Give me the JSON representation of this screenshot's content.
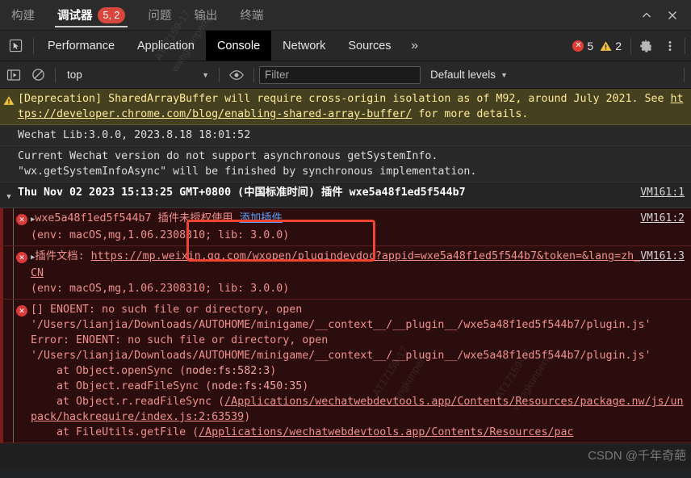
{
  "ide_bar": {
    "tabs": [
      {
        "label": "构建",
        "active": false
      },
      {
        "label": "调试器",
        "active": true,
        "badge": "5, 2"
      },
      {
        "label": "问题",
        "active": false
      },
      {
        "label": "输出",
        "active": false
      },
      {
        "label": "终端",
        "active": false
      }
    ],
    "collapse_icon": "chevron-up-icon",
    "close_icon": "close-icon"
  },
  "devtools_bar": {
    "inspect_icon": "inspect-element-icon",
    "tabs": [
      {
        "label": "Performance",
        "active": false
      },
      {
        "label": "Application",
        "active": false
      },
      {
        "label": "Console",
        "active": true
      },
      {
        "label": "Network",
        "active": false
      },
      {
        "label": "Sources",
        "active": false
      }
    ],
    "more_tabs_label": "»",
    "error_count": "5",
    "warning_count": "2",
    "settings_icon": "gear-icon",
    "kebab_icon": "more-vertical-icon"
  },
  "console_toolbar": {
    "sidebar_toggle_icon": "console-sidebar-icon",
    "clear_icon": "clear-console-icon",
    "context_value": "top",
    "context_caret": "▼",
    "live_expression_icon": "eye-icon",
    "filter_placeholder": "Filter",
    "filter_value": "",
    "levels_label": "Default levels",
    "levels_caret": "▼"
  },
  "messages": [
    {
      "id": "deprecation-warning",
      "kind": "warning",
      "icon": "warning-triangle-icon",
      "text_pre": "[Deprecation] SharedArrayBuffer will require cross-origin isolation as of M92, around July 2021. See ",
      "link": "https://developer.chrome.com/blog/enabling-shared-array-buffer/",
      "text_post": " for more details.",
      "vm": ""
    },
    {
      "id": "wechat-lib",
      "kind": "info",
      "icon": "",
      "text": "Wechat Lib:3.0.0, 2023.8.18 18:01:52",
      "vm": ""
    },
    {
      "id": "getsysteminfo-note",
      "kind": "plain",
      "icon": "",
      "text": "Current Wechat version do not support asynchronous getSystemInfo.\n\"wx.getSystemInfoAsync\" will be finished by synchronous implementation.",
      "vm": ""
    },
    {
      "id": "group-timestamp",
      "kind": "group",
      "icon": "disclosure-triangle-down-icon",
      "text": "Thu Nov 02 2023 15:13:25 GMT+0800 (中国标准时间) 插件 wxe5a48f1ed5f544b7",
      "vm": "VM161:1"
    },
    {
      "id": "plugin-unauthorized",
      "kind": "error",
      "icon": "error-circle-icon",
      "expand_icon": "disclosure-triangle-right-icon",
      "text_a": "wxe5a48f1ed5f544b7 插件未授权使用 ",
      "link_label": "添加插件",
      "text_b": "\n(env: macOS,mg,1.06.2308310; lib: 3.0.0)",
      "vm": "VM161:2"
    },
    {
      "id": "plugin-doc",
      "kind": "error",
      "icon": "error-circle-icon",
      "expand_icon": "disclosure-triangle-right-icon",
      "text_a": "插件文档: ",
      "link": "https://mp.weixin.qq.com/wxopen/plugindevdoc?appid=wxe5a48f1ed5f544b7&token=&lang=zh_CN",
      "text_b": "\n(env: macOS,mg,1.06.2308310; lib: 3.0.0)",
      "vm": "VM161:3"
    },
    {
      "id": "enoent-stack",
      "kind": "error",
      "icon": "error-circle-icon",
      "lines": [
        "[] ENOENT: no such file or directory, open",
        "'/Users/lianjia/Downloads/AUTOHOME/minigame/__context__/__plugin__/wxe5a48f1ed5f544b7/plugin.js'",
        "Error: ENOENT: no such file or directory, open",
        "'/Users/lianjia/Downloads/AUTOHOME/minigame/__context__/__plugin__/wxe5a48f1ed5f544b7/plugin.js'"
      ],
      "frames": [
        {
          "prefix": "    at Object.openSync (",
          "link": "node:fs:582:3",
          "suffix": ")",
          "linked": false
        },
        {
          "prefix": "    at Object.readFileSync (",
          "link": "node:fs:450:35",
          "suffix": ")",
          "linked": false
        },
        {
          "prefix": "    at Object.r.readFileSync (",
          "link": "/Applications/wechatwebdevtools.app/Contents/Resources/package.nw/js/unpack/hackrequire/index.js:2:63539",
          "suffix": ")",
          "linked": true
        },
        {
          "prefix": "    at FileUtils.getFile (",
          "link": "/Applications/wechatwebdevtools.app/Contents/Resources/pac",
          "suffix": "",
          "linked": true
        }
      ],
      "vm": ""
    }
  ],
  "annotation": {
    "name": "red-highlight-box",
    "color": "#f0442e"
  },
  "watermarks": {
    "diagonal_line1": "AT17159-17",
    "diagonal_line2": "wangkunpeng",
    "csdn": "CSDN @千年奇葩"
  }
}
